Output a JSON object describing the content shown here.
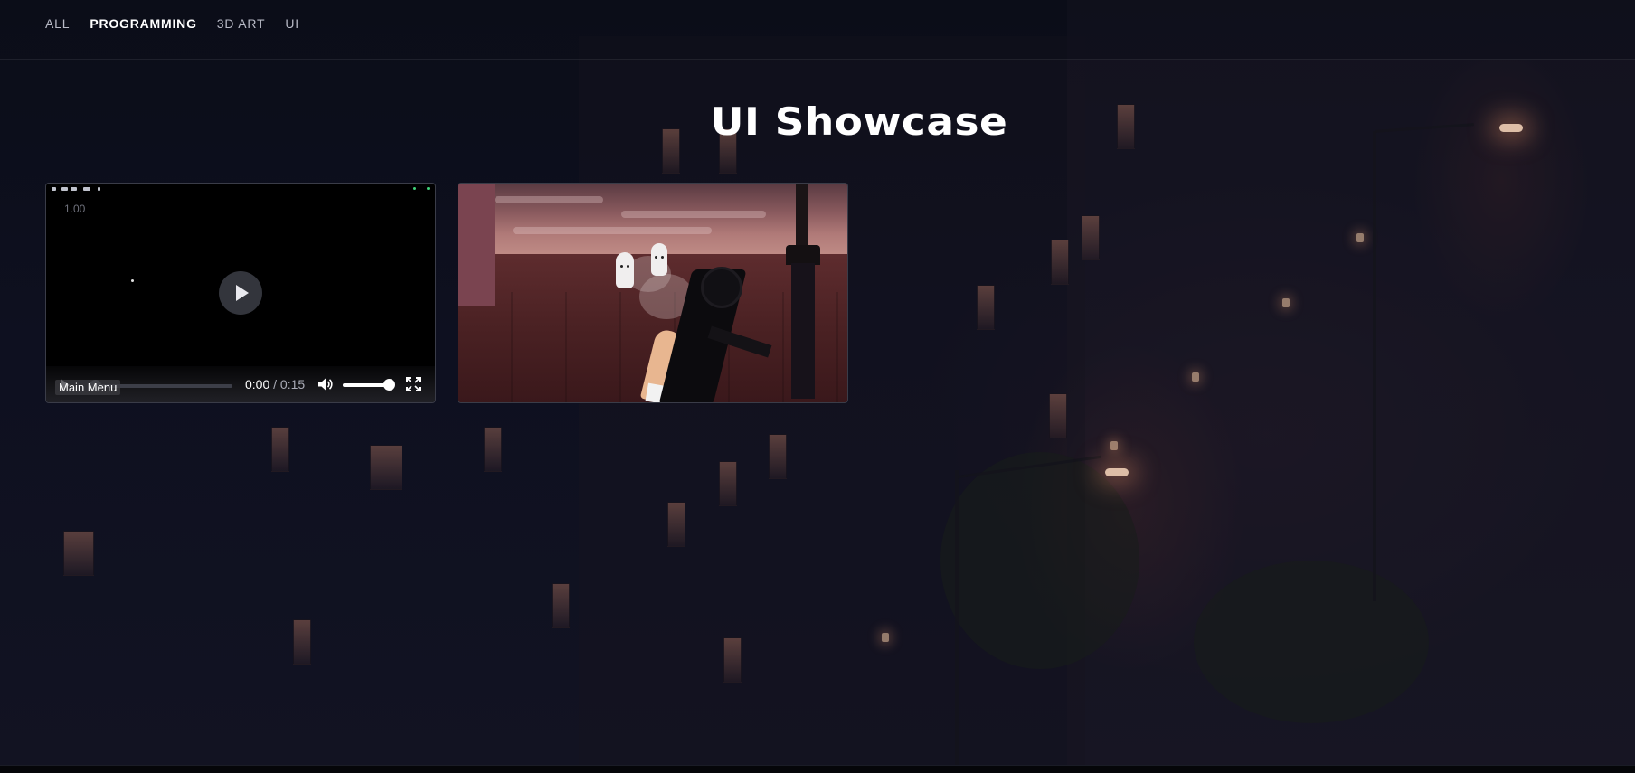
{
  "nav": {
    "items": [
      {
        "label": "ALL",
        "active": false
      },
      {
        "label": "PROGRAMMING",
        "active": true
      },
      {
        "label": "3D ART",
        "active": false
      },
      {
        "label": "UI",
        "active": false
      }
    ]
  },
  "page": {
    "title": "UI Showcase"
  },
  "video_card": {
    "zoom_label": "1.00",
    "current_time": "0:00",
    "separator": "/",
    "duration": "0:15",
    "caption": "Main Menu",
    "volume": 1.0,
    "progress": 0.0
  },
  "colors": {
    "background": "#0d0f1c",
    "nav_active": "#ffffff",
    "nav_inactive": "#b8bac6",
    "title": "#ffffff"
  },
  "icons": [
    "play-icon",
    "volume-icon",
    "fullscreen-icon"
  ]
}
